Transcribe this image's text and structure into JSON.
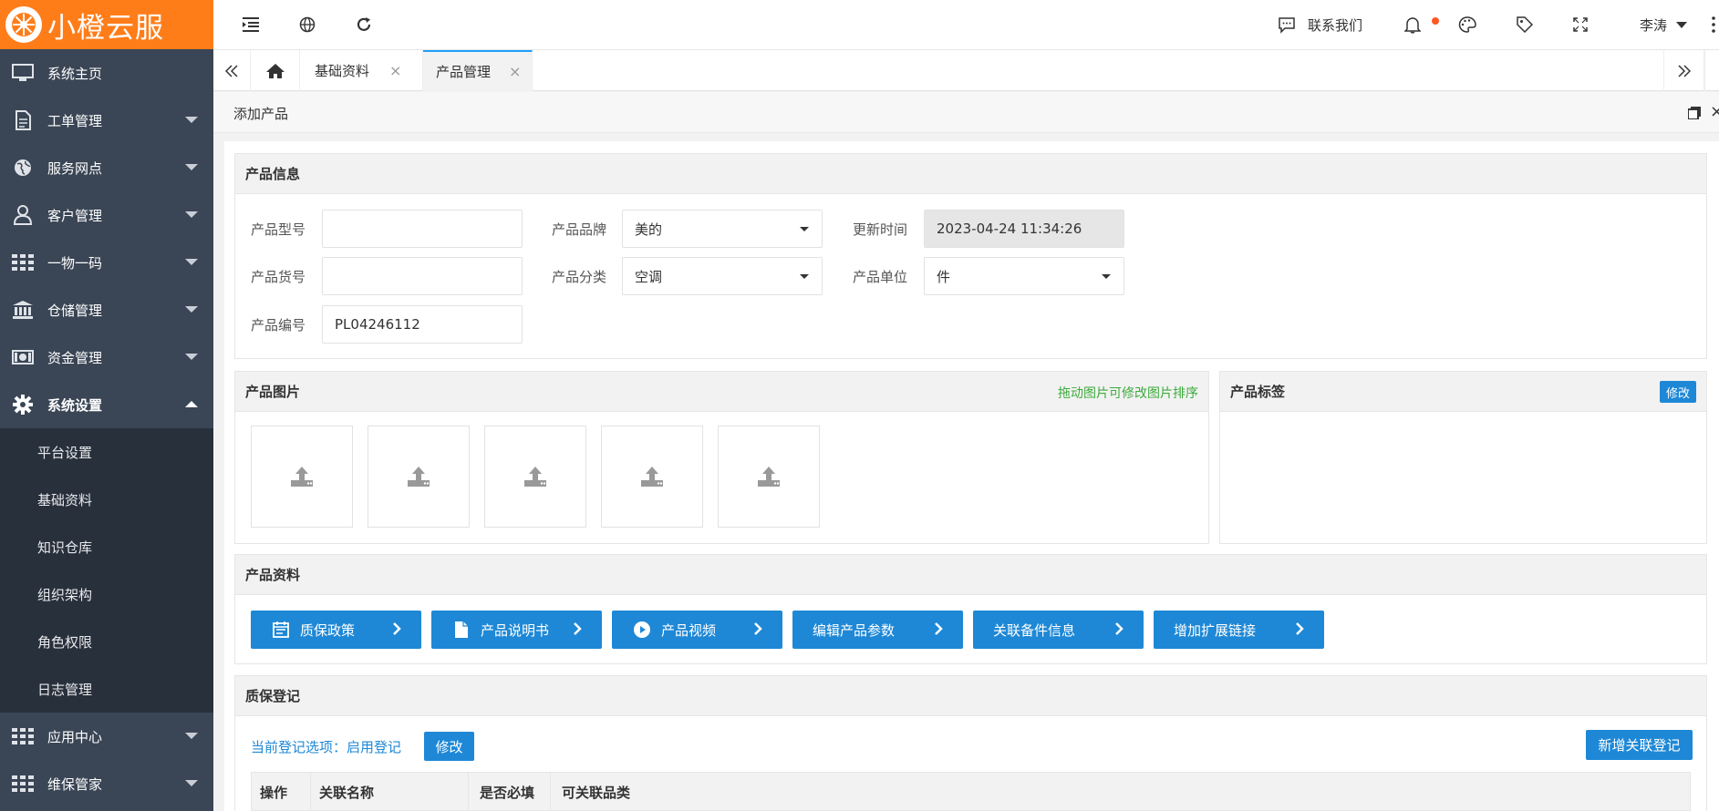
{
  "brand": {
    "name": "小橙云服",
    "color": "#ff7d19"
  },
  "sidebar": {
    "items": [
      {
        "label": "系统主页",
        "icon": "monitor-icon"
      },
      {
        "label": "工单管理",
        "icon": "document-icon"
      },
      {
        "label": "服务网点",
        "icon": "globe-icon"
      },
      {
        "label": "客户管理",
        "icon": "user-icon"
      },
      {
        "label": "一物一码",
        "icon": "grid-icon"
      },
      {
        "label": "仓储管理",
        "icon": "bank-icon"
      },
      {
        "label": "资金管理",
        "icon": "money-icon"
      },
      {
        "label": "系统设置",
        "icon": "gear-icon"
      }
    ],
    "submenu": [
      "平台设置",
      "基础资料",
      "知识仓库",
      "组织架构",
      "角色权限",
      "日志管理"
    ],
    "bottom_items": [
      {
        "label": "应用中心",
        "icon": "grid-icon"
      },
      {
        "label": "维保管家",
        "icon": "grid-icon"
      }
    ]
  },
  "topbar": {
    "contact_label": "联系我们",
    "user_name": "李涛"
  },
  "tabs": {
    "items": [
      "基础资料",
      "产品管理"
    ],
    "active_index": 1
  },
  "page": {
    "title": "添加产品"
  },
  "product_info": {
    "title": "产品信息",
    "model_label": "产品型号",
    "model_value": "",
    "brand_label": "产品品牌",
    "brand_value": "美的",
    "updated_label": "更新时间",
    "updated_value": "2023-04-24 11:34:26",
    "sku_label": "产品货号",
    "sku_value": "",
    "category_label": "产品分类",
    "category_value": "空调",
    "unit_label": "产品单位",
    "unit_value": "件",
    "code_label": "产品编号",
    "code_value": "PL04246112"
  },
  "product_images": {
    "title": "产品图片",
    "hint": "拖动图片可修改图片排序",
    "hint_color": "#3cab3c",
    "slot_count": 5
  },
  "product_tags": {
    "title": "产品标签",
    "edit_label": "修改"
  },
  "product_docs": {
    "title": "产品资料",
    "buttons": [
      {
        "label": "质保政策",
        "icon": "calendar-icon"
      },
      {
        "label": "产品说明书",
        "icon": "file-icon"
      },
      {
        "label": "产品视频",
        "icon": "play-icon"
      },
      {
        "label": "编辑产品参数",
        "icon": ""
      },
      {
        "label": "关联备件信息",
        "icon": ""
      },
      {
        "label": "增加扩展链接",
        "icon": ""
      }
    ]
  },
  "warranty": {
    "title": "质保登记",
    "current_option": "当前登记选项：启用登记",
    "edit_label": "修改",
    "add_label": "新增关联登记",
    "columns": [
      "操作",
      "关联名称",
      "是否必填",
      "可关联品类"
    ]
  },
  "colors": {
    "accent": "#1e88d6",
    "sidebar": "#3a4555",
    "submenu": "#28303c"
  }
}
